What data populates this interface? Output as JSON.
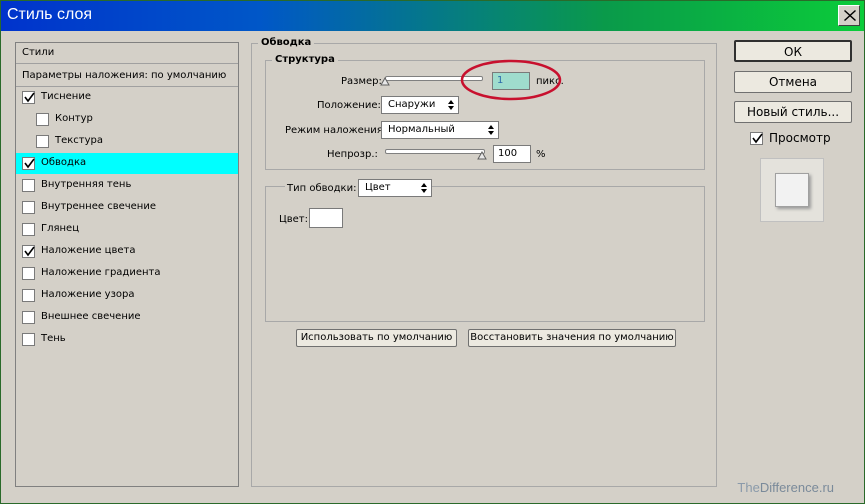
{
  "window": {
    "title": "Стиль слоя",
    "close_icon": "close-icon"
  },
  "left_list": {
    "header": "Стили",
    "blend_defaults": "Параметры наложения: по умолчанию",
    "items": [
      {
        "label": "Тиснение",
        "checked": true,
        "indent": false,
        "selected": false
      },
      {
        "label": "Контур",
        "checked": false,
        "indent": true,
        "selected": false
      },
      {
        "label": "Текстура",
        "checked": false,
        "indent": true,
        "selected": false
      },
      {
        "label": "Обводка",
        "checked": true,
        "indent": false,
        "selected": true
      },
      {
        "label": "Внутренняя тень",
        "checked": false,
        "indent": false,
        "selected": false
      },
      {
        "label": "Внутреннее свечение",
        "checked": false,
        "indent": false,
        "selected": false
      },
      {
        "label": "Глянец",
        "checked": false,
        "indent": false,
        "selected": false
      },
      {
        "label": "Наложение цвета",
        "checked": true,
        "indent": false,
        "selected": false
      },
      {
        "label": "Наложение градиента",
        "checked": false,
        "indent": false,
        "selected": false
      },
      {
        "label": "Наложение узора",
        "checked": false,
        "indent": false,
        "selected": false
      },
      {
        "label": "Внешнее свечение",
        "checked": false,
        "indent": false,
        "selected": false
      },
      {
        "label": "Тень",
        "checked": false,
        "indent": false,
        "selected": false
      }
    ]
  },
  "stroke": {
    "title": "Обводка",
    "structure_title": "Структура",
    "size_label": "Размер:",
    "size_value": "1",
    "size_unit": "пикс.",
    "position_label": "Положение:",
    "position_value": "Снаружи",
    "blend_label": "Режим наложения:",
    "blend_value": "Нормальный",
    "opacity_label": "Непрозр.:",
    "opacity_value": "100",
    "opacity_unit": "%",
    "fill_type_label": "Тип обводки:",
    "fill_type_value": "Цвет",
    "color_label": "Цвет:",
    "color_value": "#ffffff",
    "use_default_button": "Использовать по умолчанию",
    "restore_default_button": "Восстановить значения по умолчанию"
  },
  "side": {
    "ok_button": "ОК",
    "cancel_button": "Отмена",
    "new_style_button": "Новый стиль...",
    "preview_label": "Просмотр",
    "preview_checked": true
  },
  "watermark": {
    "prefix": "The",
    "rest": "Difference.ru"
  },
  "colors": {
    "selection": "#00ffff",
    "highlight_ring": "#c8102e",
    "title_start": "#0033cc",
    "title_end": "#0bcc3a"
  }
}
